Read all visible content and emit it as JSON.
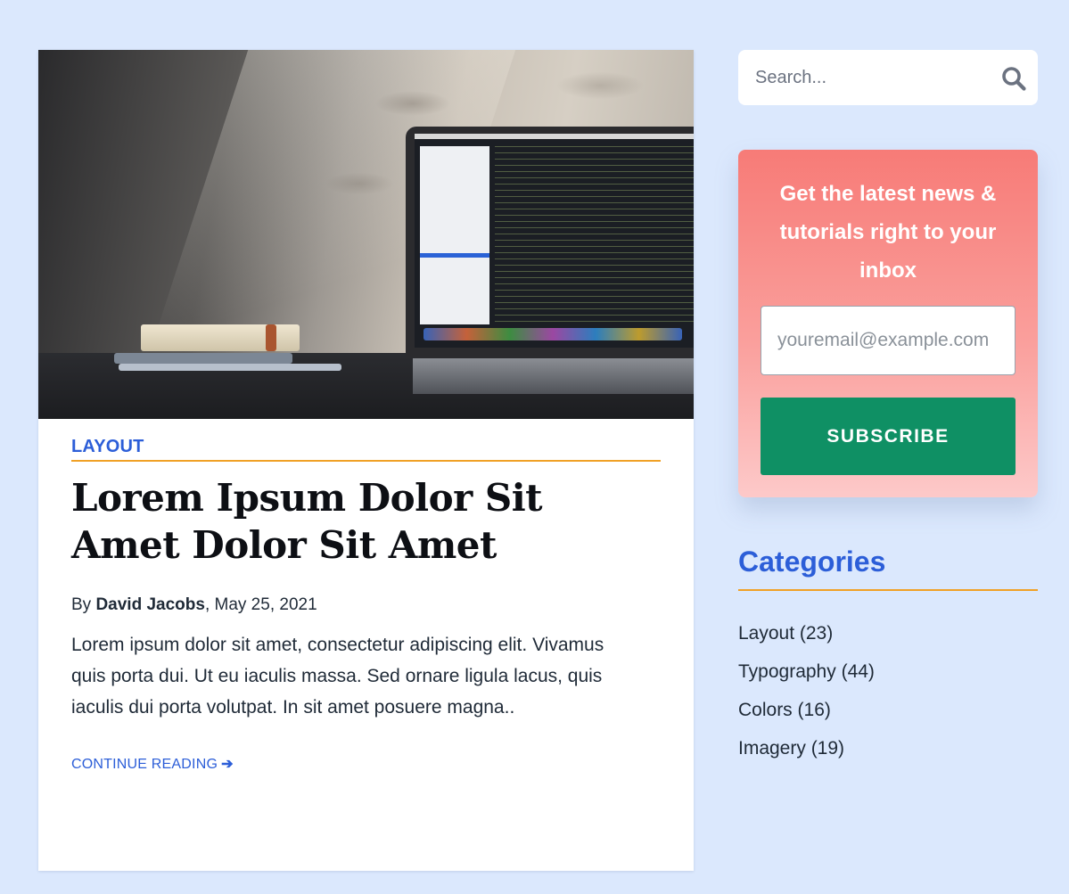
{
  "article": {
    "category": "LAYOUT",
    "title": "Lorem Ipsum Dolor Sit Amet Dolor Sit Amet",
    "byline_prefix": "By ",
    "author": "David Jacobs",
    "date_suffix": ", May 25, 2021",
    "excerpt": "Lorem ipsum dolor sit amet, consectetur adipiscing elit. Vivamus quis porta dui. Ut eu iaculis massa. Sed ornare ligula lacus, quis iaculis dui porta volutpat. In sit amet posuere magna..",
    "continue_label": "CONTINUE READING",
    "continue_arrow": "➔",
    "hero_image": "laptop-on-desk-with-books"
  },
  "search": {
    "placeholder": "Search...",
    "icon": "search-icon"
  },
  "newsletter": {
    "heading": "Get the latest news & tutorials right to your inbox",
    "email_placeholder": "youremail@example.com",
    "button_label": "SUBSCRIBE"
  },
  "categories": {
    "title": "Categories",
    "items": [
      {
        "label": "Layout (23)"
      },
      {
        "label": "Typography (44)"
      },
      {
        "label": "Colors (16)"
      },
      {
        "label": "Imagery (19)"
      }
    ]
  },
  "colors": {
    "page_background": "#dbe8fd",
    "accent_blue": "#2c5ed8",
    "accent_orange": "#f0a126",
    "subscribe_green": "#0f9064",
    "newsletter_top": "#f77b77",
    "newsletter_bottom": "#fdc9c9"
  }
}
